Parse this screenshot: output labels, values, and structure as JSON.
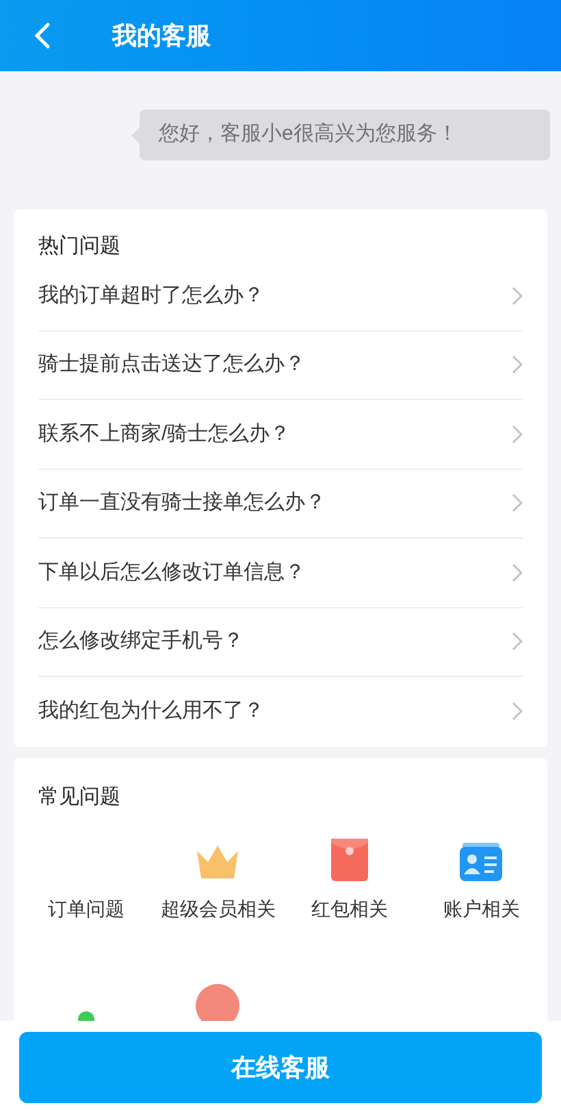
{
  "header": {
    "title": "我的客服"
  },
  "greeting": "您好，客服小e很高兴为您服务！",
  "hot_questions": {
    "title": "热门问题",
    "items": [
      "我的订单超时了怎么办？",
      "骑士提前点击送达了怎么办？",
      "联系不上商家/骑士怎么办？",
      "订单一直没有骑士接单怎么办？",
      "下单以后怎么修改订单信息？",
      "怎么修改绑定手机号？",
      "我的红包为什么用不了？"
    ]
  },
  "common_questions": {
    "title": "常见问题",
    "items": [
      {
        "label": "订单问题",
        "kind": "none"
      },
      {
        "label": "超级会员相关",
        "kind": "crown"
      },
      {
        "label": "红包相关",
        "kind": "redpacket"
      },
      {
        "label": "账户相关",
        "kind": "card"
      },
      {
        "kind": "greendot"
      },
      {
        "kind": "redcircle"
      }
    ]
  },
  "bottom_button": "在线客服"
}
